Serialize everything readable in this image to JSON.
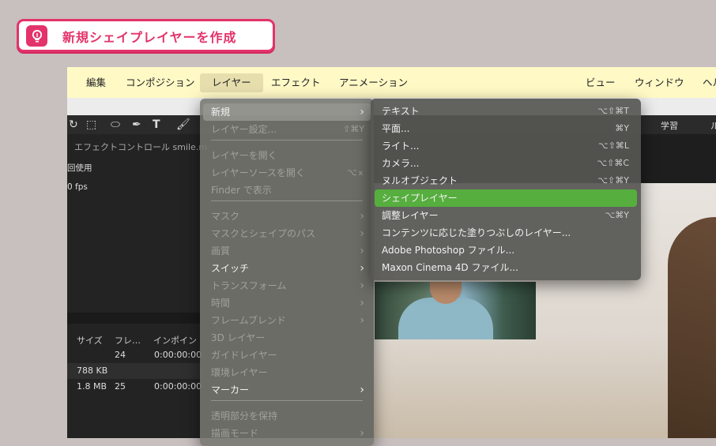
{
  "tip": {
    "text": "新規シェイプレイヤーを作成",
    "icon": "lightbulb-icon",
    "accent": "#e3336a"
  },
  "menubar": {
    "items": [
      "編集",
      "コンポジション",
      "レイヤー",
      "エフェクト",
      "アニメーション",
      "ビュー",
      "ウィンドウ",
      "ヘル"
    ]
  },
  "toolbar": {
    "right_label": "学習",
    "right_tail": "ル"
  },
  "left_panel": {
    "tab": "エフェクトコントロール smile.m",
    "line1": "回使用",
    "line2": "0 fps",
    "table": {
      "headers": [
        "サイズ",
        "フレ…",
        "インポイン"
      ],
      "rows": [
        [
          "",
          "24",
          "0:00:00:00"
        ],
        [
          "788 KB",
          "",
          ""
        ],
        [
          "1.8 MB",
          "25",
          "0:00:00:00"
        ]
      ]
    }
  },
  "layer_menu": {
    "items": [
      {
        "label": "新規",
        "shortcut": "",
        "submenu": true,
        "enabled": true,
        "highlighted": true
      },
      {
        "label": "レイヤー設定...",
        "shortcut": "⇧⌘Y",
        "submenu": false,
        "enabled": false
      },
      {
        "label": "レイヤーを開く",
        "shortcut": "",
        "submenu": false,
        "enabled": false
      },
      {
        "label": "レイヤーソースを開く",
        "shortcut": "⌥⌅",
        "submenu": false,
        "enabled": false
      },
      {
        "label": "Finder で表示",
        "shortcut": "",
        "submenu": false,
        "enabled": false
      },
      {
        "label": "マスク",
        "shortcut": "",
        "submenu": true,
        "enabled": false
      },
      {
        "label": "マスクとシェイプのパス",
        "shortcut": "",
        "submenu": true,
        "enabled": false
      },
      {
        "label": "画質",
        "shortcut": "",
        "submenu": true,
        "enabled": false
      },
      {
        "label": "スイッチ",
        "shortcut": "",
        "submenu": true,
        "enabled": true
      },
      {
        "label": "トランスフォーム",
        "shortcut": "",
        "submenu": true,
        "enabled": false
      },
      {
        "label": "時間",
        "shortcut": "",
        "submenu": true,
        "enabled": false
      },
      {
        "label": "フレームブレンド",
        "shortcut": "",
        "submenu": true,
        "enabled": false
      },
      {
        "label": "3D レイヤー",
        "shortcut": "",
        "submenu": false,
        "enabled": false
      },
      {
        "label": "ガイドレイヤー",
        "shortcut": "",
        "submenu": false,
        "enabled": false
      },
      {
        "label": "環境レイヤー",
        "shortcut": "",
        "submenu": false,
        "enabled": false
      },
      {
        "label": "マーカー",
        "shortcut": "",
        "submenu": true,
        "enabled": true
      },
      {
        "label": "透明部分を保持",
        "shortcut": "",
        "submenu": false,
        "enabled": false
      },
      {
        "label": "描画モード",
        "shortcut": "",
        "submenu": true,
        "enabled": false
      }
    ]
  },
  "new_submenu": {
    "items": [
      {
        "label": "テキスト",
        "shortcut": "⌥⇧⌘T"
      },
      {
        "label": "平面...",
        "shortcut": "⌘Y"
      },
      {
        "label": "ライト...",
        "shortcut": "⌥⇧⌘L"
      },
      {
        "label": "カメラ...",
        "shortcut": "⌥⇧⌘C"
      },
      {
        "label": "ヌルオブジェクト",
        "shortcut": "⌥⇧⌘Y"
      },
      {
        "label": "シェイプレイヤー",
        "shortcut": "",
        "selected": true
      },
      {
        "label": "調整レイヤー",
        "shortcut": "⌥⌘Y"
      },
      {
        "label": "コンテンツに応じた塗りつぶしのレイヤー...",
        "shortcut": ""
      },
      {
        "label": "Adobe Photoshop ファイル...",
        "shortcut": ""
      },
      {
        "label": "Maxon Cinema 4D ファイル...",
        "shortcut": ""
      }
    ],
    "selected_color": "#56ae3e"
  }
}
